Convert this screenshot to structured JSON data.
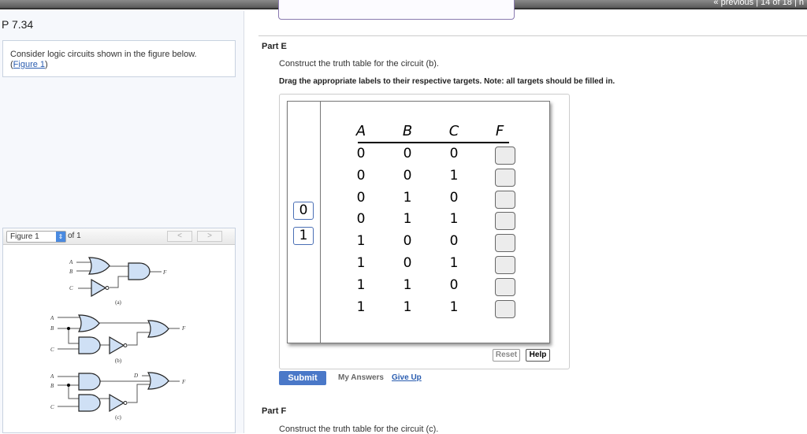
{
  "topnav": {
    "text": "« previous  |  14 of 18  |  n"
  },
  "problem": {
    "title": "P 7.34",
    "intro": "Consider logic circuits shown in the figure below.",
    "figure_link": "Figure 1"
  },
  "figure": {
    "selected": "Figure 1",
    "of_label": "of 1",
    "prev": "<",
    "next": ">",
    "labels": {
      "a": "(a)",
      "b": "(b)",
      "c": "(c)",
      "A": "A",
      "B": "B",
      "C": "C",
      "D": "D",
      "F": "F"
    }
  },
  "partE": {
    "title": "Part E",
    "question": "Construct the truth table for the circuit (b).",
    "instruction": "Drag the appropriate labels to their respective targets. Note: all targets should be filled in.",
    "source_labels": [
      "0",
      "1"
    ],
    "headers": [
      "A",
      "B",
      "C",
      "F"
    ],
    "rows": [
      [
        "0",
        "0",
        "0"
      ],
      [
        "0",
        "0",
        "1"
      ],
      [
        "0",
        "1",
        "0"
      ],
      [
        "0",
        "1",
        "1"
      ],
      [
        "1",
        "0",
        "0"
      ],
      [
        "1",
        "0",
        "1"
      ],
      [
        "1",
        "1",
        "0"
      ],
      [
        "1",
        "1",
        "1"
      ]
    ],
    "reset": "Reset",
    "help": "Help",
    "submit": "Submit",
    "my_answers": "My Answers",
    "give_up": "Give Up"
  },
  "partF": {
    "title": "Part F",
    "question": "Construct the truth table for the circuit (c)."
  },
  "colors": {
    "accent": "#4a78c8",
    "link": "#2a5db0",
    "gate_fill": "#cfe0f5"
  }
}
